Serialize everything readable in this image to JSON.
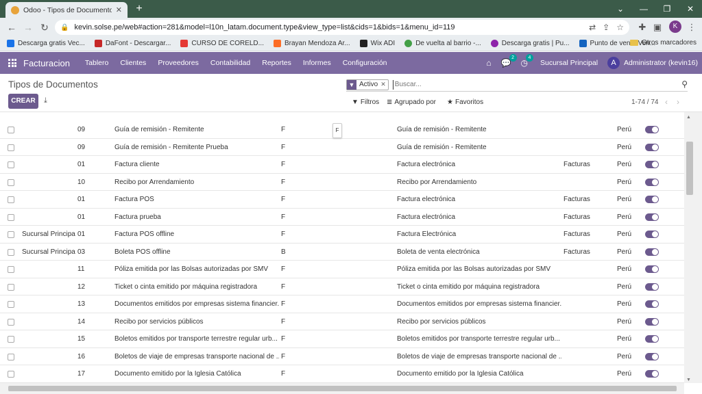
{
  "browser": {
    "tab_title": "Odoo - Tipos de Documentos",
    "url": "kevin.solse.pe/web#action=281&model=l10n_latam.document.type&view_type=list&cids=1&bids=1&menu_id=119",
    "profile_initial": "K",
    "bookmarks": [
      {
        "label": "Descarga gratis Vec...",
        "color": "#1a73e8"
      },
      {
        "label": "DaFont - Descargar...",
        "color": "#c62828"
      },
      {
        "label": "CURSO DE CORELD...",
        "color": "#e53935"
      },
      {
        "label": "Brayan Mendoza Ar...",
        "color": "#fc6d26"
      },
      {
        "label": "Wix ADI",
        "color": "#222222"
      },
      {
        "label": "De vuelta al barrio -...",
        "color": "#43a047"
      },
      {
        "label": "Descarga gratis | Pu...",
        "color": "#8e24aa"
      },
      {
        "label": "Punto de venta Ven...",
        "color": "#1565c0"
      }
    ],
    "other_bookmarks": "Otros marcadores"
  },
  "navbar": {
    "brand": "Facturacion",
    "menu": [
      "Tablero",
      "Clientes",
      "Proveedores",
      "Contabilidad",
      "Reportes",
      "Informes",
      "Configuración"
    ],
    "messages_count": "2",
    "activities_count": "4",
    "company": "Sucursal Principal",
    "user_initial": "A",
    "user": "Administrator (kevin16)"
  },
  "control": {
    "breadcrumb": "Tipos de Documentos",
    "create_label": "CREAR",
    "facet_label": "Activo",
    "search_placeholder": "Buscar...",
    "filters_label": "Filtros",
    "groupby_label": "Agrupado por",
    "favorites_label": "Favoritos",
    "pager": "1-74 / 74"
  },
  "tooltip": "F",
  "rows": [
    {
      "branch": "",
      "code": "09",
      "name": "Guía de remisión - Remitente",
      "letter": "F",
      "report": "Guía de remisión - Remitente",
      "type": "",
      "country": "Perú"
    },
    {
      "branch": "",
      "code": "09",
      "name": "Guía de remisión - Remitente Prueba",
      "letter": "F",
      "report": "Guía de remisión - Remitente",
      "type": "",
      "country": "Perú"
    },
    {
      "branch": "",
      "code": "01",
      "name": "Factura cliente",
      "letter": "F",
      "report": "Factura electrónica",
      "type": "Facturas",
      "country": "Perú"
    },
    {
      "branch": "",
      "code": "10",
      "name": "Recibo por Arrendamiento",
      "letter": "F",
      "report": "Recibo por Arrendamiento",
      "type": "",
      "country": "Perú"
    },
    {
      "branch": "",
      "code": "01",
      "name": "Factura POS",
      "letter": "F",
      "report": "Factura electrónica",
      "type": "Facturas",
      "country": "Perú"
    },
    {
      "branch": "",
      "code": "01",
      "name": "Factura prueba",
      "letter": "F",
      "report": "Factura electrónica",
      "type": "Facturas",
      "country": "Perú"
    },
    {
      "branch": "Sucursal Principal",
      "code": "01",
      "name": "Factura POS offline",
      "letter": "F",
      "report": "Factura Electrónica",
      "type": "Facturas",
      "country": "Perú"
    },
    {
      "branch": "Sucursal Principal",
      "code": "03",
      "name": "Boleta POS offline",
      "letter": "B",
      "report": "Boleta de venta electrónica",
      "type": "Facturas",
      "country": "Perú"
    },
    {
      "branch": "",
      "code": "11",
      "name": "Póliza emitida por las Bolsas autorizadas por SMV",
      "letter": "F",
      "report": "Póliza emitida por las Bolsas autorizadas por SMV",
      "type": "",
      "country": "Perú"
    },
    {
      "branch": "",
      "code": "12",
      "name": "Ticket o cinta emitido por máquina registradora",
      "letter": "F",
      "report": "Ticket o cinta emitido por máquina registradora",
      "type": "",
      "country": "Perú"
    },
    {
      "branch": "",
      "code": "13",
      "name": "Documentos emitidos por empresas sistema financier...",
      "letter": "F",
      "report": "Documentos emitidos por empresas sistema financier...",
      "type": "",
      "country": "Perú"
    },
    {
      "branch": "",
      "code": "14",
      "name": "Recibo por servicios públicos",
      "letter": "F",
      "report": "Recibo por servicios públicos",
      "type": "",
      "country": "Perú"
    },
    {
      "branch": "",
      "code": "15",
      "name": "Boletos emitidos por transporte terrestre regular urb...",
      "letter": "F",
      "report": "Boletos emitidos por transporte terrestre regular urb...",
      "type": "",
      "country": "Perú"
    },
    {
      "branch": "",
      "code": "16",
      "name": "Boletos de viaje de empresas transporte nacional de ...",
      "letter": "F",
      "report": "Boletos de viaje de empresas transporte nacional de ...",
      "type": "",
      "country": "Perú"
    },
    {
      "branch": "",
      "code": "17",
      "name": "Documento emitido por la Iglesia Católica",
      "letter": "F",
      "report": "Documento emitido por la Iglesia Católica",
      "type": "",
      "country": "Perú"
    }
  ]
}
